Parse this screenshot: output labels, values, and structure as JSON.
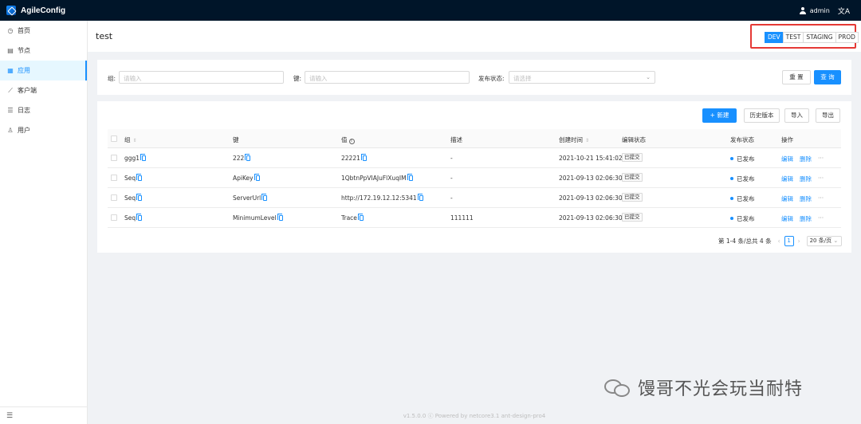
{
  "app": {
    "title": "AgileConfig"
  },
  "topbar": {
    "user": "admin",
    "lang_icon": "文A"
  },
  "sidebar": {
    "items": [
      {
        "label": "首页",
        "icon": "dashboard-icon",
        "glyph": "◷"
      },
      {
        "label": "节点",
        "icon": "node-icon",
        "glyph": "▤"
      },
      {
        "label": "应用",
        "icon": "app-icon",
        "glyph": "▦"
      },
      {
        "label": "客户端",
        "icon": "client-icon",
        "glyph": "⟋"
      },
      {
        "label": "日志",
        "icon": "log-icon",
        "glyph": "☰"
      },
      {
        "label": "用户",
        "icon": "user-icon",
        "glyph": "♙"
      }
    ],
    "active_index": 2,
    "collapse_icon": "☰"
  },
  "header": {
    "title": "test",
    "envs": [
      "DEV",
      "TEST",
      "STAGING",
      "PROD"
    ],
    "active_env": "DEV"
  },
  "filter": {
    "group_label": "组:",
    "group_placeholder": "请输入",
    "key_label": "键:",
    "key_placeholder": "请输入",
    "status_label": "发布状态:",
    "status_placeholder": "请选择",
    "reset_label": "重 置",
    "query_label": "查 询"
  },
  "toolbar": {
    "new_label": "新建",
    "history_label": "历史版本",
    "import_label": "导入",
    "export_label": "导出"
  },
  "table": {
    "columns": [
      "组",
      "键",
      "值",
      "描述",
      "创建时间",
      "编辑状态",
      "发布状态",
      "操作"
    ],
    "rows": [
      {
        "group": "ggg1",
        "key": "222",
        "value": "22221",
        "desc": "-",
        "created": "2021-10-21 15:41:02",
        "edit_status": "已提交",
        "publish_status": "已发布"
      },
      {
        "group": "Seq",
        "key": "ApiKey",
        "value": "1QbtnPpVIAJuFlXuqIM",
        "desc": "-",
        "created": "2021-09-13 02:06:30",
        "edit_status": "已提交",
        "publish_status": "已发布"
      },
      {
        "group": "Seq",
        "key": "ServerUrl",
        "value": "http://172.19.12.12:5341",
        "desc": "-",
        "created": "2021-09-13 02:06:30",
        "edit_status": "已提交",
        "publish_status": "已发布"
      },
      {
        "group": "Seq",
        "key": "MinimumLevel",
        "value": "Trace",
        "desc": "111111",
        "created": "2021-09-13 02:06:30",
        "edit_status": "已提交",
        "publish_status": "已发布"
      }
    ],
    "actions": {
      "edit": "编辑",
      "delete": "删除",
      "more": "···"
    }
  },
  "pagination": {
    "summary": "第 1-4 条/总共 4 条",
    "current_page": "1",
    "page_size": "20 条/页"
  },
  "footer": {
    "text": "v1.5.0.0  ⓒ  Powered by netcore3.1 ant-design-pro4"
  },
  "watermark": {
    "text": "馒哥不光会玩当耐特"
  }
}
